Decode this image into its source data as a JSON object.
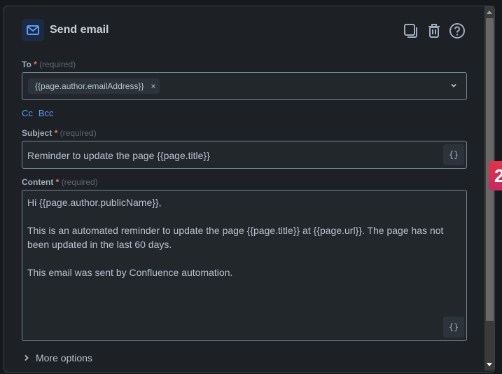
{
  "header": {
    "title": "Send email",
    "icons": [
      "mail-icon",
      "duplicate-icon",
      "trash-icon",
      "help-icon"
    ]
  },
  "to": {
    "label": "To",
    "required_mark": "*",
    "required_text": "(required)",
    "chip": "{{page.author.emailAddress}}",
    "chip_remove": "×"
  },
  "cc_label": "Cc",
  "bcc_label": "Bcc",
  "subject": {
    "label": "Subject",
    "required_mark": "*",
    "required_text": "(required)",
    "value": "Reminder to update the page {{page.title}}",
    "insert_label": "{}"
  },
  "content": {
    "label": "Content",
    "required_mark": "*",
    "required_text": "(required)",
    "lines": [
      "Hi {{page.author.publicName}},",
      "This is an automated reminder to update the page {{page.title}} at {{page.url}}. The page has not been updated in the last 60 days.",
      "This email was sent by Confluence automation."
    ],
    "insert_label": "{}"
  },
  "more_options": "More options",
  "badge": "2"
}
